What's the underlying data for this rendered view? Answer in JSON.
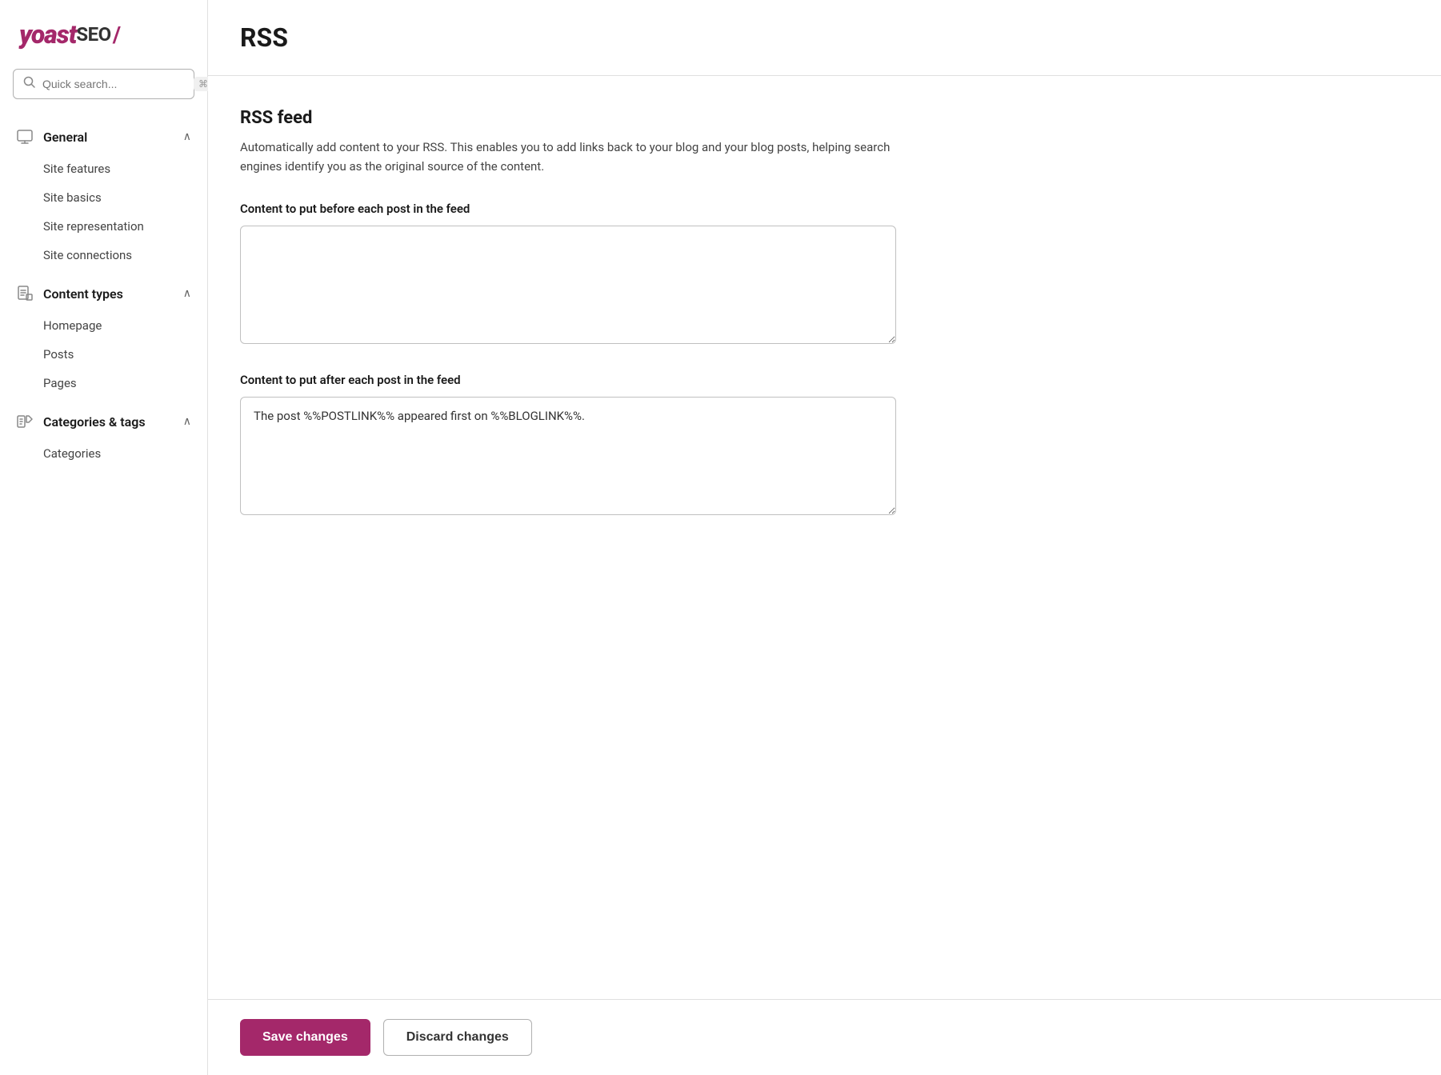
{
  "logo": {
    "yoast": "yoast",
    "seo": "SEO",
    "slash": "/"
  },
  "search": {
    "placeholder": "Quick search...",
    "shortcut": "⌘K"
  },
  "sidebar": {
    "sections": [
      {
        "id": "general",
        "label": "General",
        "expanded": true,
        "items": [
          {
            "id": "site-features",
            "label": "Site features"
          },
          {
            "id": "site-basics",
            "label": "Site basics"
          },
          {
            "id": "site-representation",
            "label": "Site representation"
          },
          {
            "id": "site-connections",
            "label": "Site connections"
          }
        ]
      },
      {
        "id": "content-types",
        "label": "Content types",
        "expanded": true,
        "items": [
          {
            "id": "homepage",
            "label": "Homepage"
          },
          {
            "id": "posts",
            "label": "Posts"
          },
          {
            "id": "pages",
            "label": "Pages"
          }
        ]
      },
      {
        "id": "categories-tags",
        "label": "Categories & tags",
        "expanded": true,
        "items": [
          {
            "id": "categories",
            "label": "Categories"
          }
        ]
      }
    ]
  },
  "page": {
    "title": "RSS"
  },
  "rss_feed": {
    "section_title": "RSS feed",
    "description": "Automatically add content to your RSS. This enables you to add links back to your blog and your blog posts, helping search engines identify you as the original source of the content.",
    "before_label": "Content to put before each post in the feed",
    "before_value": "",
    "after_label": "Content to put after each post in the feed",
    "after_value": "The post %%POSTLINK%% appeared first on %%BLOGLINK%%."
  },
  "footer": {
    "save_label": "Save changes",
    "discard_label": "Discard changes"
  }
}
